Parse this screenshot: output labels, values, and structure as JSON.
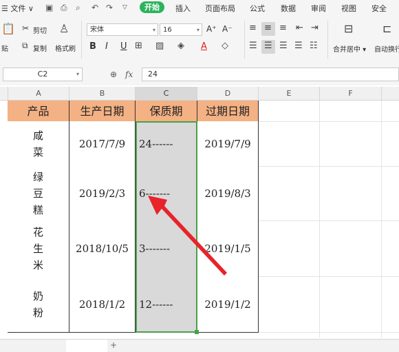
{
  "menu": {
    "file": "文件",
    "start": "开始",
    "tabs": [
      "插入",
      "页面布局",
      "公式",
      "数据",
      "审阅",
      "视图",
      "安全"
    ]
  },
  "ribbon": {
    "cut": "剪切",
    "copy": "复制",
    "paste_partial": "贴",
    "format_painter": "格式刷",
    "font_name": "宋体",
    "font_size": "16",
    "merge_center": "合并居中",
    "auto_wrap": "自动换行",
    "bold": "B",
    "italic": "I",
    "underline": "U",
    "font_color_letter": "A",
    "grow_font": "A⁺",
    "shrink_font": "A⁻"
  },
  "formula_bar": {
    "name_box": "C2",
    "fx": "fx",
    "value": "24"
  },
  "columns": [
    "A",
    "B",
    "C",
    "D",
    "E",
    "F"
  ],
  "table": {
    "headers": [
      "产品",
      "生产日期",
      "保质期",
      "过期日期"
    ],
    "rows": [
      {
        "product": "咸\n菜",
        "prod_date": "2017/7/9",
        "shelf": "24------",
        "exp_date": "2019/7/9"
      },
      {
        "product": "绿\n豆\n糕",
        "prod_date": "2019/2/3",
        "shelf": "6-------",
        "exp_date": "2019/8/3"
      },
      {
        "product": "花\n生\n米",
        "prod_date": "2018/10/5",
        "shelf": "3-------",
        "exp_date": "2019/1/5"
      },
      {
        "product": "奶\n粉",
        "prod_date": "2018/1/2",
        "shelf": "12------",
        "exp_date": "2019/1/2"
      }
    ]
  },
  "colors": {
    "header_fill": "#f4b183",
    "selection_fill": "#d9d9d9",
    "selection_border": "#4a9f4a",
    "accent_green": "#2db35d",
    "arrow": "#e8232a"
  },
  "icons": [
    "save-icon",
    "print-icon",
    "preview-icon",
    "undo-icon",
    "redo-icon",
    "scissors-icon",
    "copy-icon",
    "paint-brush-icon",
    "zoom-icon"
  ]
}
